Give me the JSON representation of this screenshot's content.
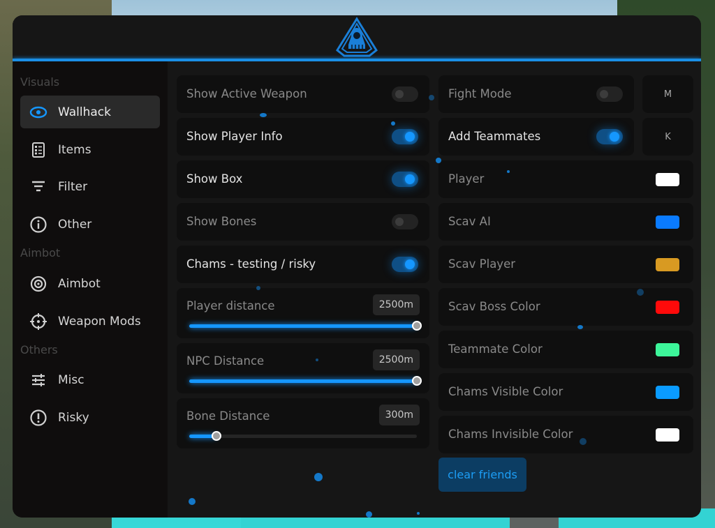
{
  "app": {
    "logo": "hooded-figure-shield-logo",
    "accent_color": "#1a8fe6"
  },
  "sidebar": {
    "sections": [
      {
        "title": "Visuals",
        "items": [
          {
            "label": "Wallhack",
            "icon": "eye-icon",
            "active": true
          },
          {
            "label": "Items",
            "icon": "checklist-icon",
            "active": false
          },
          {
            "label": "Filter",
            "icon": "filter-icon",
            "active": false
          },
          {
            "label": "Other",
            "icon": "info-icon",
            "active": false
          }
        ]
      },
      {
        "title": "Aimbot",
        "items": [
          {
            "label": "Aimbot",
            "icon": "target-icon",
            "active": false
          },
          {
            "label": "Weapon Mods",
            "icon": "crosshair-icon",
            "active": false
          }
        ]
      },
      {
        "title": "Others",
        "items": [
          {
            "label": "Misc",
            "icon": "sliders-icon",
            "active": false
          },
          {
            "label": "Risky",
            "icon": "alert-icon",
            "active": false
          }
        ]
      }
    ]
  },
  "left_column": {
    "toggles": [
      {
        "label": "Show Active Weapon",
        "enabled": false
      },
      {
        "label": "Show Player Info",
        "enabled": true
      },
      {
        "label": "Show Box",
        "enabled": true
      },
      {
        "label": "Show Bones",
        "enabled": false
      },
      {
        "label": "Chams - testing / risky",
        "enabled": true
      }
    ],
    "sliders": [
      {
        "label": "Player distance",
        "value": "2500m",
        "fraction": 1.0
      },
      {
        "label": "NPC Distance",
        "value": "2500m",
        "fraction": 1.0
      },
      {
        "label": "Bone Distance",
        "value": "300m",
        "fraction": 0.12
      }
    ]
  },
  "right_column": {
    "toggles": [
      {
        "label": "Fight Mode",
        "enabled": false,
        "keybind": "M"
      },
      {
        "label": "Add Teammates",
        "enabled": true,
        "keybind": "K"
      }
    ],
    "colors": [
      {
        "label": "Player",
        "color": "#ffffff"
      },
      {
        "label": "Scav AI",
        "color": "#0a7bff"
      },
      {
        "label": "Scav Player",
        "color": "#d89a22"
      },
      {
        "label": "Scav Boss Color",
        "color": "#ff0a0a"
      },
      {
        "label": "Teammate Color",
        "color": "#3df59a"
      },
      {
        "label": "Chams Visible Color",
        "color": "#0a9bff"
      },
      {
        "label": "Chams Invisible Color",
        "color": "#ffffff"
      }
    ],
    "clear_button": "clear friends"
  }
}
